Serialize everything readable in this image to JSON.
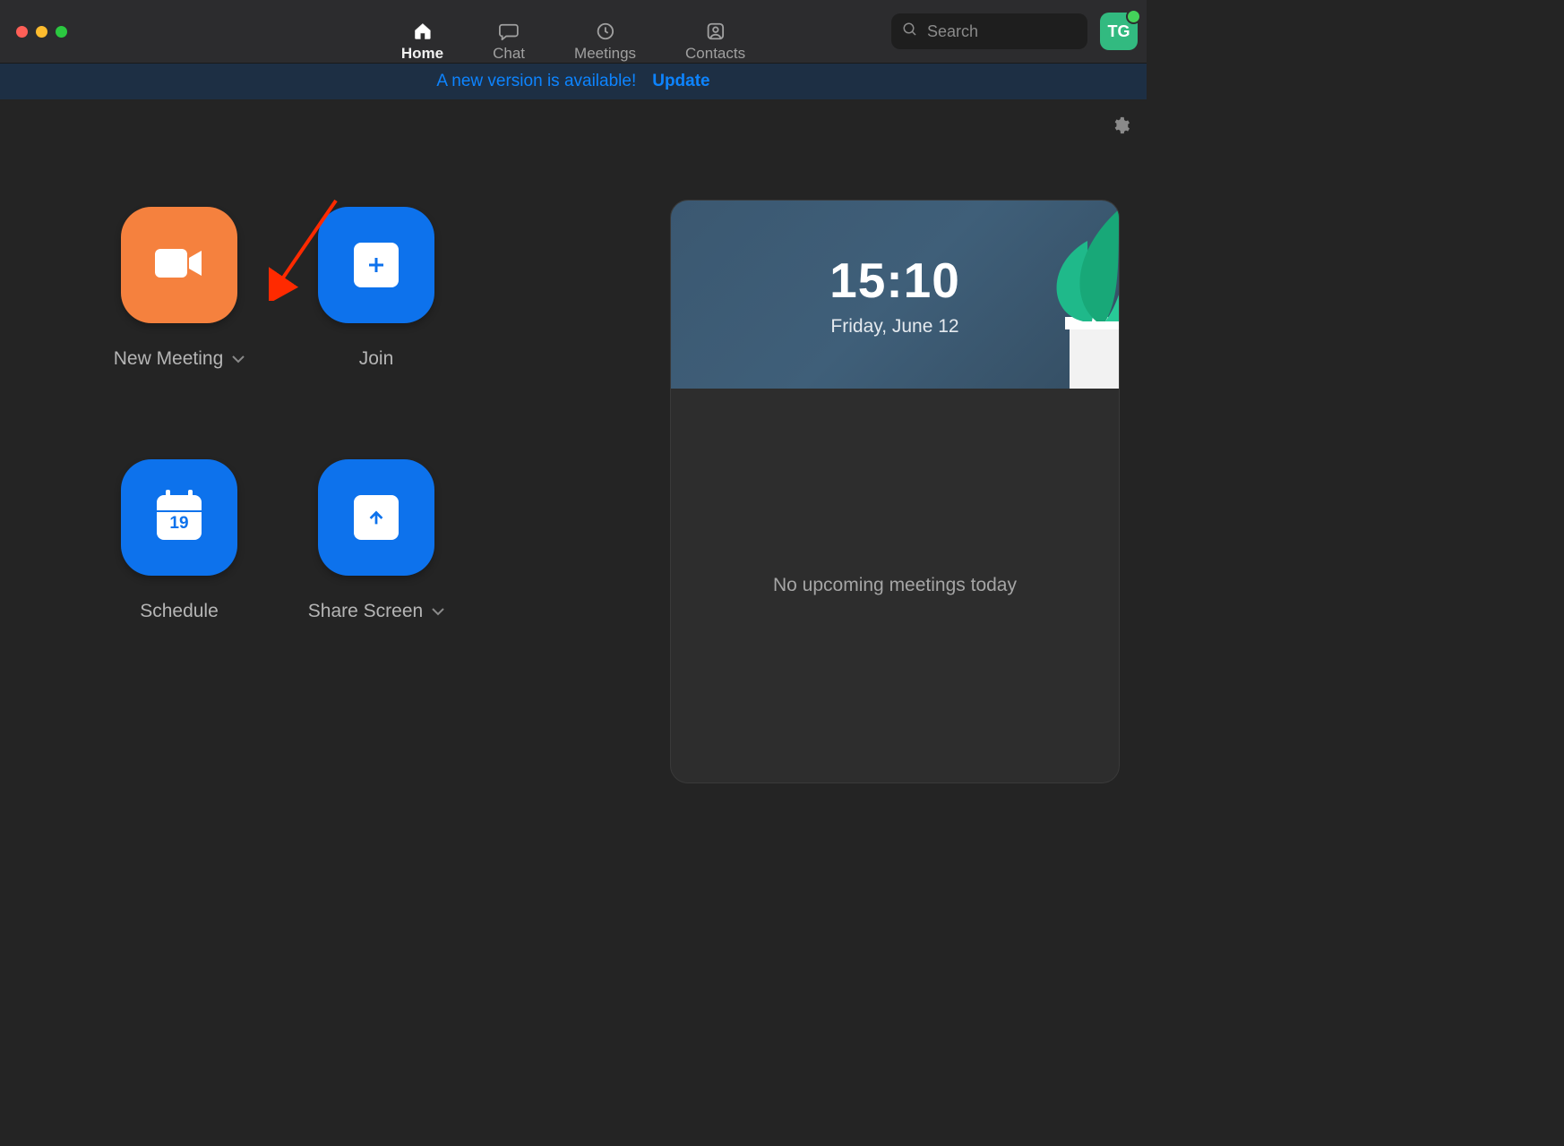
{
  "nav": {
    "items": [
      {
        "label": "Home"
      },
      {
        "label": "Chat"
      },
      {
        "label": "Meetings"
      },
      {
        "label": "Contacts"
      }
    ]
  },
  "search": {
    "placeholder": "Search"
  },
  "avatar": {
    "initials": "TG"
  },
  "banner": {
    "message": "A new version is available!",
    "action": "Update"
  },
  "tiles": {
    "new_meeting": {
      "label": "New Meeting"
    },
    "join": {
      "label": "Join"
    },
    "schedule": {
      "label": "Schedule",
      "calendar_day": "19"
    },
    "share_screen": {
      "label": "Share Screen"
    }
  },
  "panel": {
    "time": "15:10",
    "date": "Friday, June 12",
    "empty_message": "No upcoming meetings today"
  }
}
